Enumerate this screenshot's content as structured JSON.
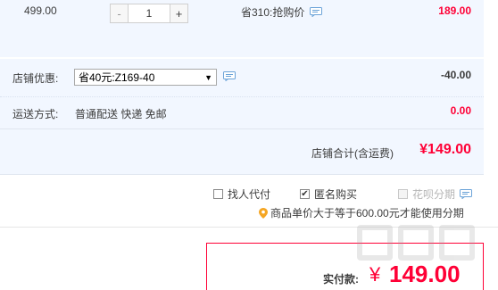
{
  "item": {
    "unit_price": "499.00",
    "stepper": {
      "minus": "-",
      "quantity": "1",
      "plus": "+"
    },
    "savings_text": "省310:抢购价",
    "savings_icon": "chat-bubble-icon",
    "total": "189.00"
  },
  "shop": {
    "coupon_label": "店铺优惠:",
    "coupon_selected": "省40元:Z169-40",
    "coupon_arrow": "▼",
    "coupon_discount": "-40.00",
    "shipping_label": "运送方式:",
    "shipping_text": "普通配送 快递 免邮",
    "shipping_cost": "0.00",
    "subtotal_label": "店铺合计(含运费)",
    "subtotal_value": "¥149.00"
  },
  "options": {
    "proxy_pay": "找人代付",
    "anonymous": "匿名购买",
    "anonymous_check": "✔",
    "huabei": "花呗分期",
    "huabei_tip": "商品单价大于等于600.00元才能使用分期"
  },
  "payment": {
    "label": "实付款:",
    "currency": "¥",
    "value": "149.00"
  },
  "colors": {
    "accent": "#ff0036",
    "panel_bg": "#f2f7ff",
    "icon_blue": "#6ba3d8",
    "tip_orange": "#f5a623"
  }
}
